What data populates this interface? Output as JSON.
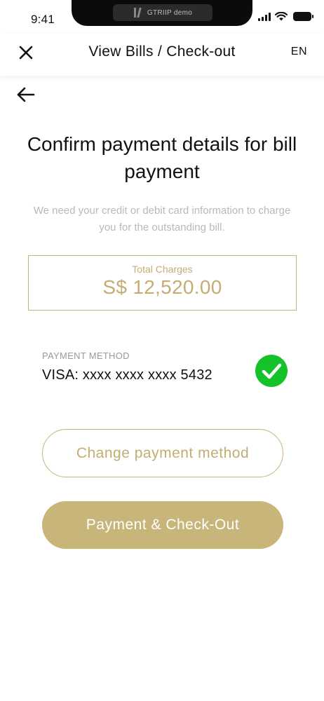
{
  "status_bar": {
    "time": "9:41",
    "notch_label": "GTRIIP demo"
  },
  "header": {
    "title": "View Bills / Check-out",
    "language": "EN"
  },
  "main": {
    "heading": "Confirm payment details for bill payment",
    "subtext": "We need your credit or debit card information to charge you for the outstanding bill.",
    "charges": {
      "label": "Total Charges",
      "amount": "S$ 12,520.00"
    },
    "payment_method": {
      "label": "PAYMENT METHOD",
      "value": "VISA: xxxx xxxx xxxx 5432",
      "verified": true
    },
    "buttons": {
      "change": "Change payment method",
      "pay": "Payment & Check-Out"
    }
  },
  "colors": {
    "accent_gold": "#c8b57a",
    "success_green": "#16c22a"
  },
  "icons": {
    "close": "close-icon",
    "back": "arrow-left-icon",
    "check": "check-circle-icon"
  }
}
